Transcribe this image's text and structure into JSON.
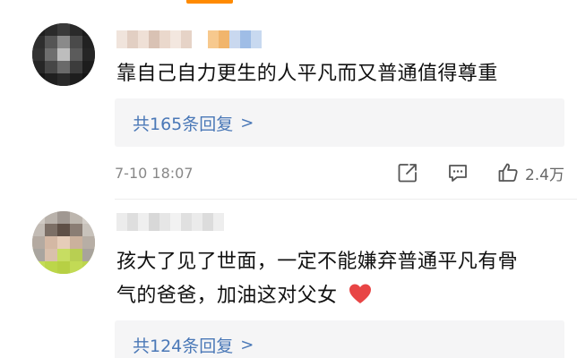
{
  "comments": [
    {
      "text_line1": "靠自己自力更生的人平凡而又普通值得尊重",
      "replies_label": "共165条回复",
      "replies_chevron": ">",
      "timestamp": "7-10 18:07",
      "like_count": "2.4万"
    },
    {
      "text_line1": "孩大了见了世面，一定不能嫌弃普通平凡有骨",
      "text_line2": "气的爸爸，加油这对父女",
      "replies_label": "共124条回复",
      "replies_chevron": ">"
    }
  ],
  "colors": {
    "accent": "#ff8a00",
    "link_blue": "#4a78b7",
    "heart_red": "#e84545"
  },
  "icons": [
    "share-icon",
    "comment-icon",
    "like-icon",
    "heart-icon",
    "chevron-right-icon"
  ]
}
